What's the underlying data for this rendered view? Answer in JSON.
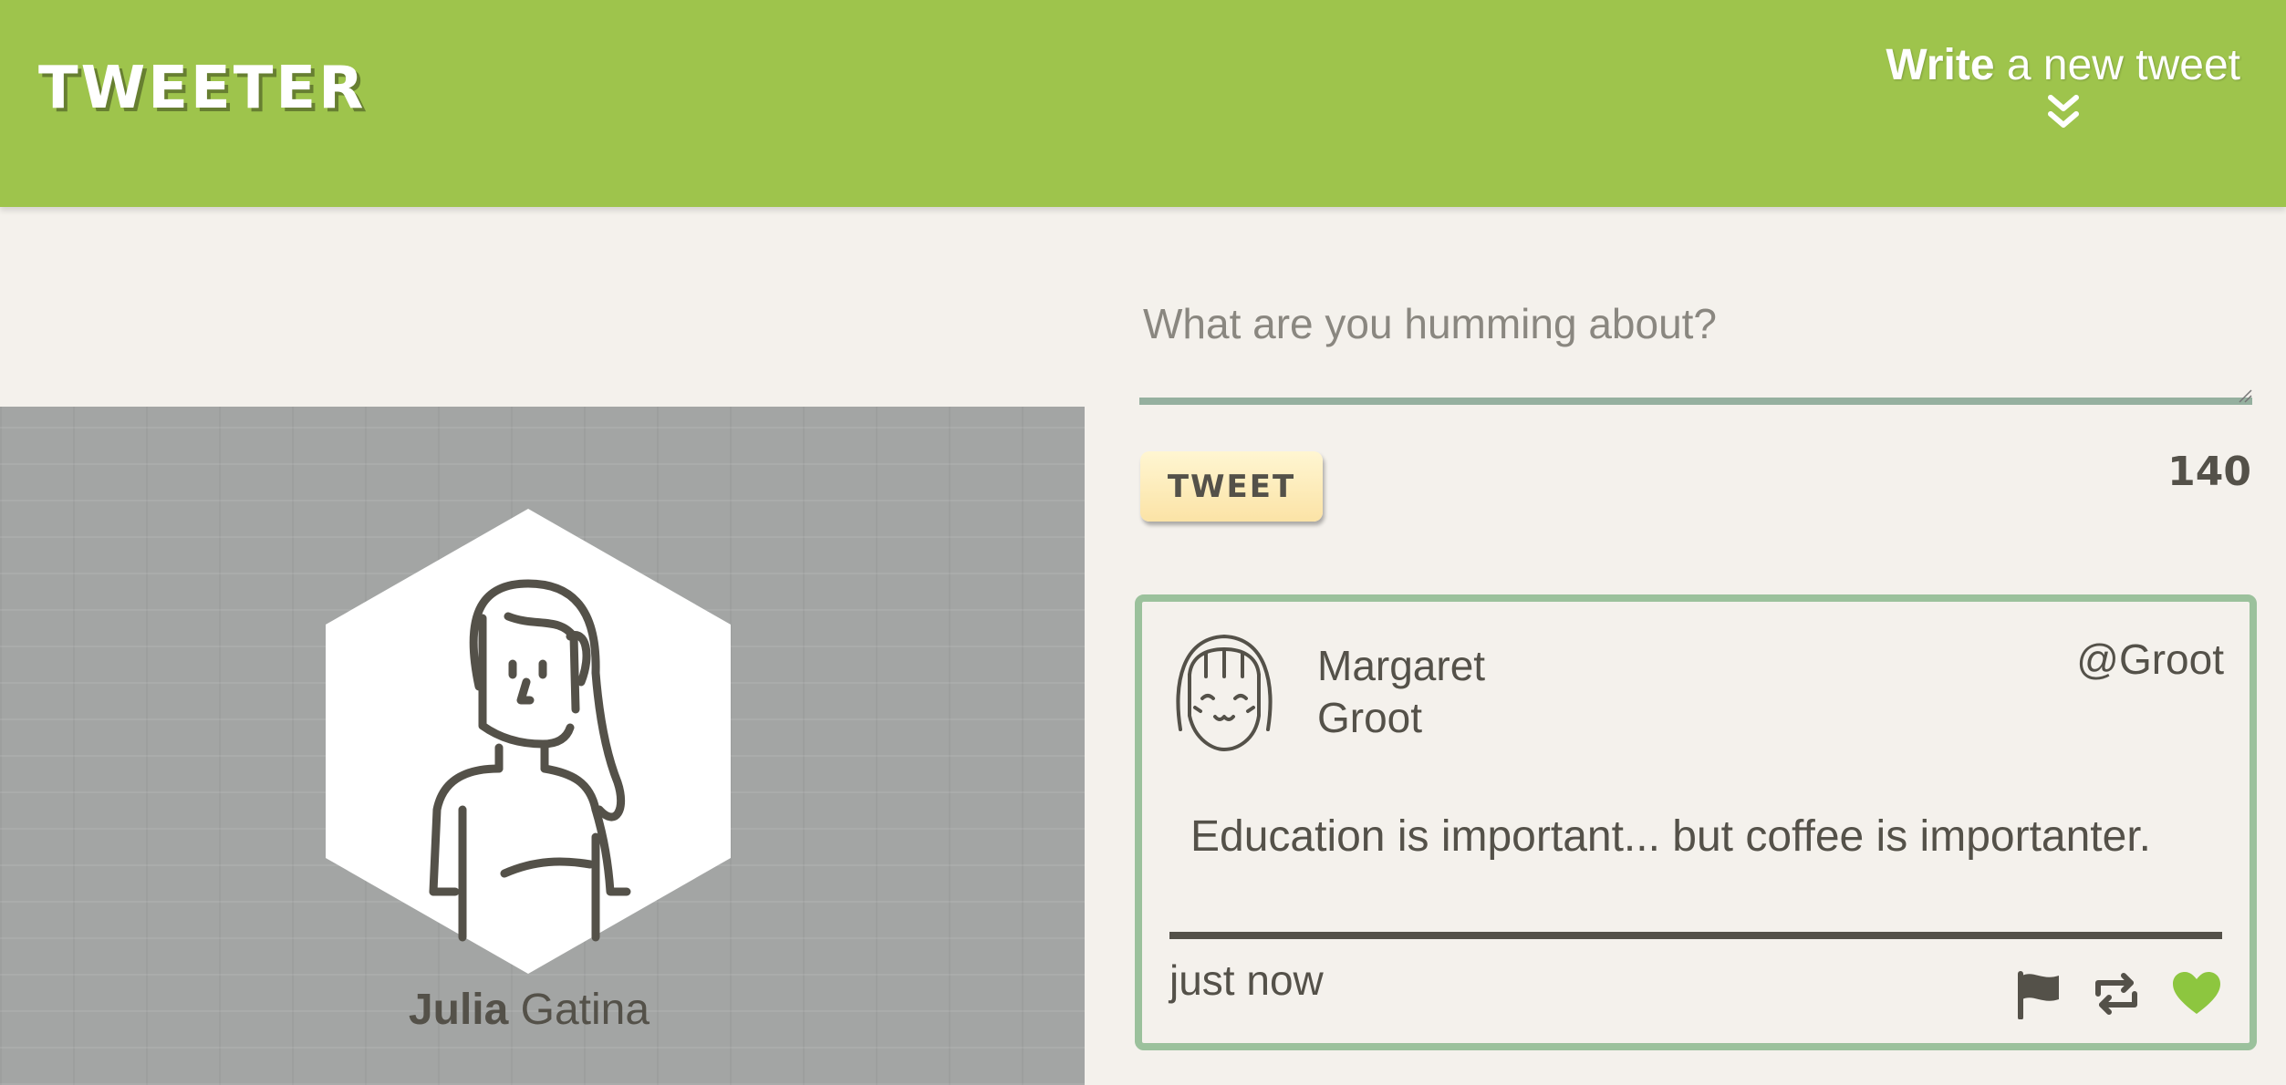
{
  "header": {
    "logo": "TWEETER",
    "compose_toggle_bold": "Write",
    "compose_toggle_rest": " a new tweet",
    "toggle_icon": "chevron-double-down-icon",
    "bg_color": "#9ec44c"
  },
  "compose": {
    "placeholder": "What are you humming about?",
    "value": "",
    "button_label": "TWEET",
    "char_counter": "140"
  },
  "profile": {
    "first_name": "Julia",
    "last_name": " Gatina",
    "avatar_icon": "woman-avatar-icon"
  },
  "tweets": [
    {
      "name": "Margaret Groot",
      "handle": "@Groot",
      "text": "Education is important... but coffee is importanter.",
      "time": "just now",
      "avatar_icon": "smiling-girl-avatar-icon",
      "actions": [
        "flag-icon",
        "retweet-icon",
        "heart-icon"
      ],
      "liked_color": "#8dc63f"
    }
  ]
}
